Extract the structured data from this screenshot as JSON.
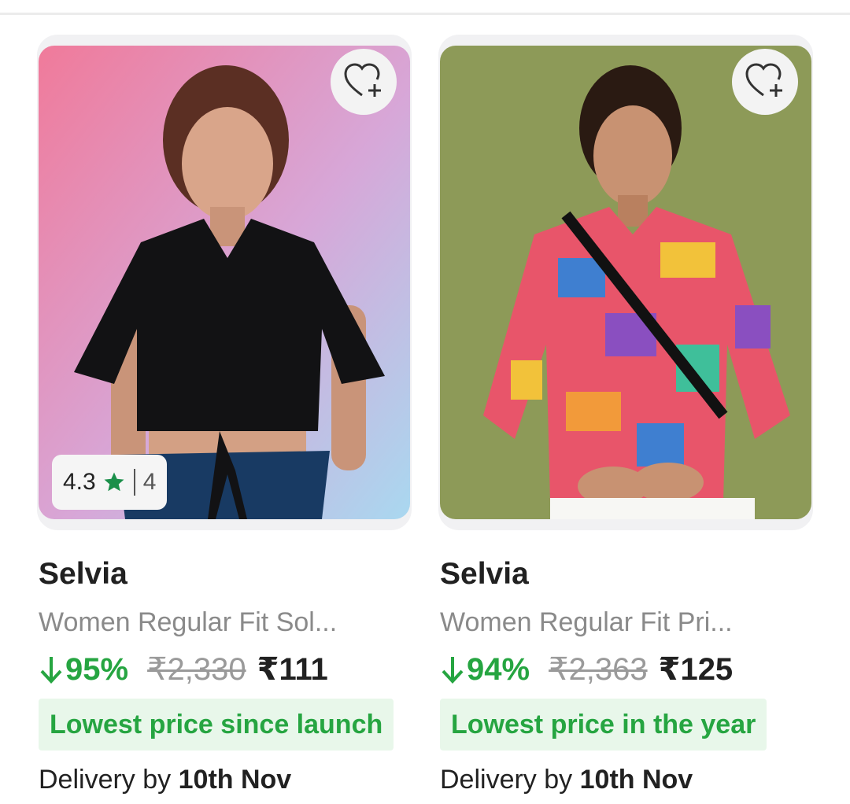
{
  "colors": {
    "accent_green": "#26a541",
    "tag_background": "#e8f7ea",
    "star_green": "#1b8f4a"
  },
  "products": [
    {
      "brand": "Selvia",
      "title": "Women Regular Fit Sol...",
      "discount": "95%",
      "mrp": "₹2,330",
      "price": "₹111",
      "tag": "Lowest price since launch",
      "delivery_prefix": "Delivery by",
      "delivery_date": "10th Nov",
      "rating": "4.3",
      "rating_count": "4",
      "icons": [
        "heart-plus-icon",
        "star-icon",
        "arrow-down-icon"
      ]
    },
    {
      "brand": "Selvia",
      "title": "Women Regular Fit Pri...",
      "discount": "94%",
      "mrp": "₹2,363",
      "price": "₹125",
      "tag": "Lowest price in the year",
      "delivery_prefix": "Delivery by",
      "delivery_date": "10th Nov",
      "icons": [
        "heart-plus-icon",
        "arrow-down-icon"
      ]
    }
  ]
}
